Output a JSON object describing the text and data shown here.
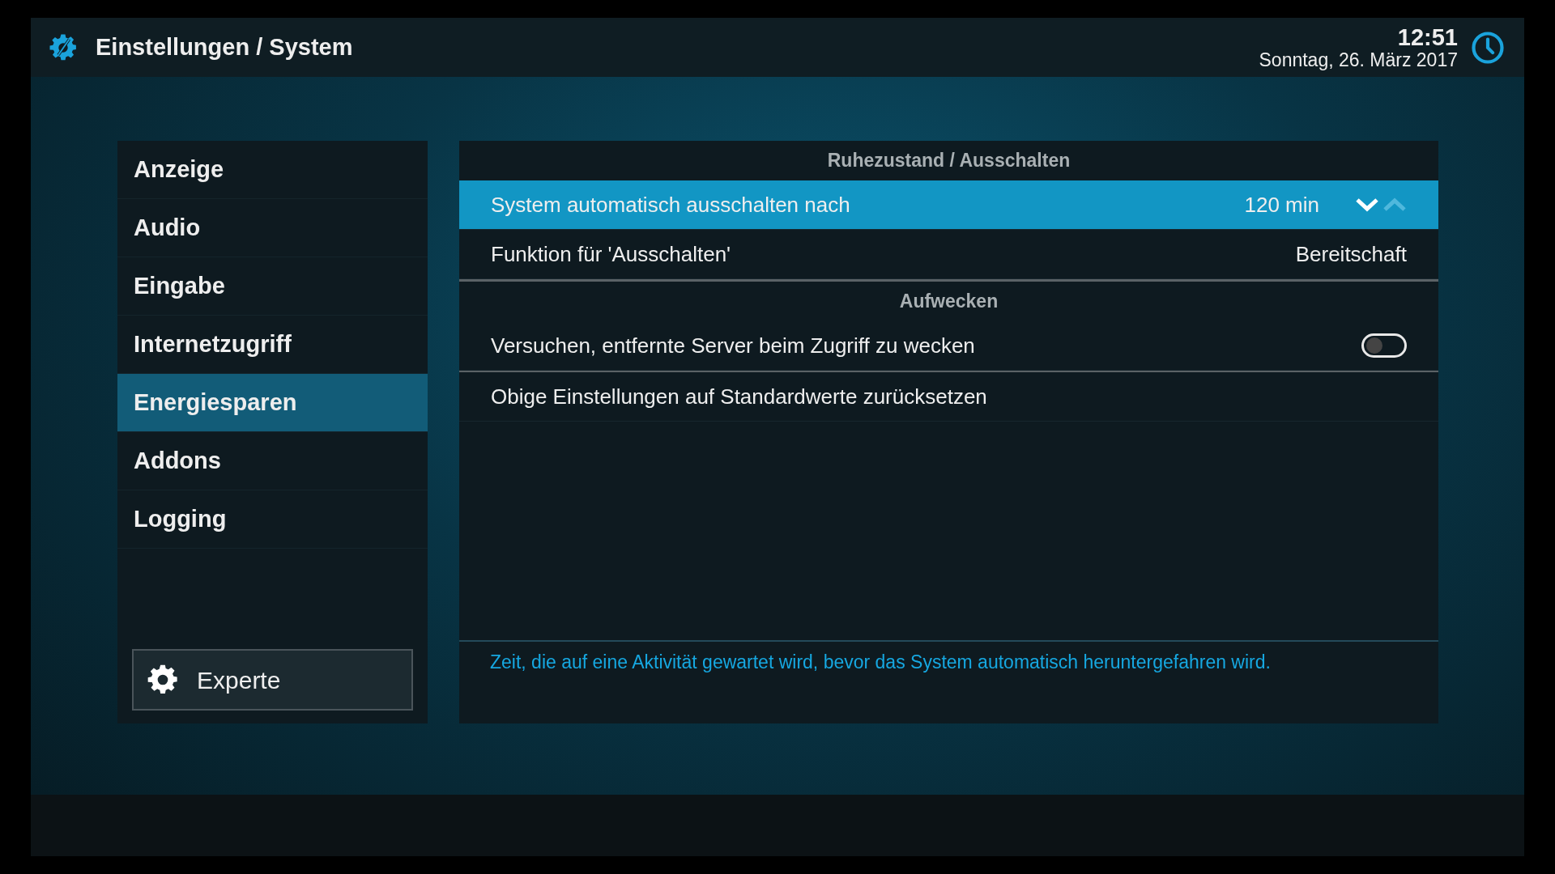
{
  "header": {
    "title": "Einstellungen / System",
    "time": "12:51",
    "date": "Sonntag, 26. März 2017"
  },
  "sidebar": {
    "items": [
      {
        "label": "Anzeige",
        "selected": false
      },
      {
        "label": "Audio",
        "selected": false
      },
      {
        "label": "Eingabe",
        "selected": false
      },
      {
        "label": "Internetzugriff",
        "selected": false
      },
      {
        "label": "Energiesparen",
        "selected": true
      },
      {
        "label": "Addons",
        "selected": false
      },
      {
        "label": "Logging",
        "selected": false
      }
    ],
    "expert_button": "Experte"
  },
  "sections": [
    {
      "heading": "Ruhezustand / Ausschalten",
      "settings": [
        {
          "kind": "spinner",
          "label": "System automatisch ausschalten nach",
          "value": "120 min",
          "selected": true
        },
        {
          "kind": "value",
          "label": "Funktion für 'Ausschalten'",
          "value": "Bereitschaft",
          "selected": false
        }
      ]
    },
    {
      "heading": "Aufwecken",
      "settings": [
        {
          "kind": "toggle",
          "label": "Versuchen, entfernte Server beim Zugriff zu wecken",
          "on": false,
          "selected": false
        }
      ]
    }
  ],
  "reset_action": "Obige Einstellungen auf Standardwerte zurücksetzen",
  "description": "Zeit, die auf eine Aktivität gewartet wird, bevor das System automatisch heruntergefahren wird."
}
